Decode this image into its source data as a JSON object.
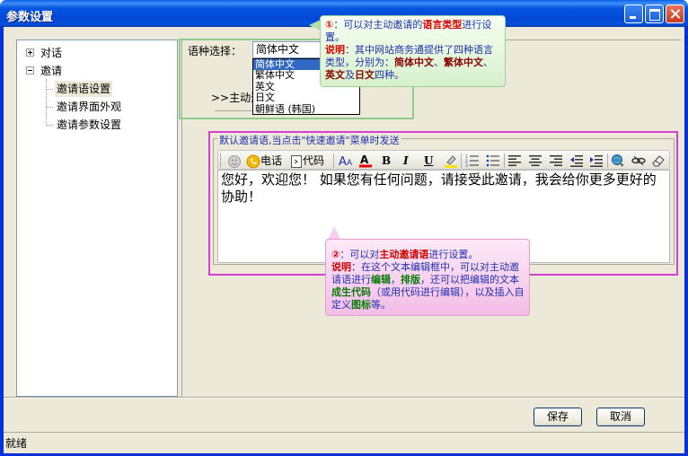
{
  "window": {
    "title": "参数设置"
  },
  "tree": {
    "items": [
      {
        "label": "对话",
        "expander": "+"
      },
      {
        "label": "邀请",
        "expander": "-"
      },
      {
        "label": "邀请语设置"
      },
      {
        "label": "邀请界面外观"
      },
      {
        "label": "邀请参数设置"
      }
    ]
  },
  "language": {
    "label": "语种选择：",
    "selected": "简体中文",
    "options": [
      "简体中文",
      "繁体中文",
      "英文",
      "日文",
      "朝鲜语 (韩国)"
    ],
    "preview": ">>主动邀"
  },
  "tip1": {
    "num": "①",
    "p1": "：可以对主动邀请的",
    "h1": "语言类型",
    "p2": "进行设置。",
    "note": "说明",
    "p3": "：其中网站商务通提供了四种语言类型，分别为：",
    "l1": "简体中文",
    "sep1": "、",
    "l2": "繁体中文",
    "sep2": "、",
    "l3": "英文",
    "sep3": "及",
    "l4": "日文",
    "p4": "四种。"
  },
  "editor": {
    "group_title": "默认邀请语,当点击\"快速邀请\"菜单时发送",
    "toolbar": {
      "phone": "电话",
      "code": "代码"
    },
    "text": "您好，欢迎您！  如果您有任何问题，请接受此邀请，我会给你更多更好的协助！"
  },
  "tip2": {
    "num": "②",
    "p1": "：可以对",
    "h1": "主动邀请语",
    "p2": "进行设置。",
    "note": "说明",
    "p3": "：在这个文本编辑框中，可以对主动邀请语进行",
    "e1": "编辑",
    "c1": "，",
    "e2": "排版",
    "p4": "，还可以把编辑的文本",
    "e3": "成生代码",
    "p5": "（或用代码进行编辑），以及插入自定义",
    "e4": "图标",
    "p6": "等。"
  },
  "buttons": {
    "save": "保存",
    "cancel": "取消"
  },
  "status": "就绪"
}
